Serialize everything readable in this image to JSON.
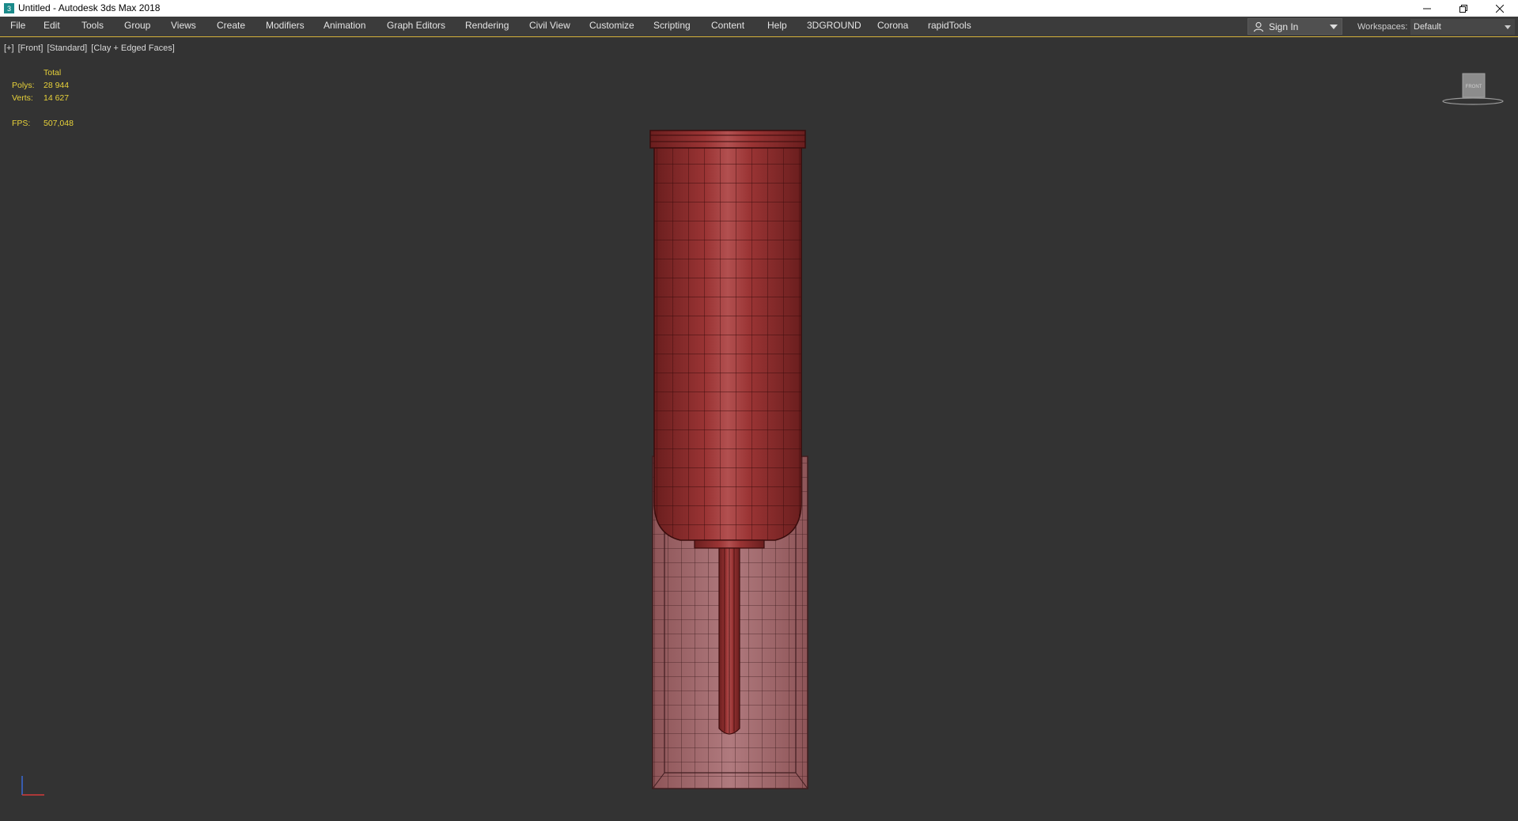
{
  "window": {
    "title": "Untitled - Autodesk 3ds Max 2018"
  },
  "menubar": {
    "items": [
      "File",
      "Edit",
      "Tools",
      "Group",
      "Views",
      "Create",
      "Modifiers",
      "Animation",
      "Graph Editors",
      "Rendering",
      "Civil View",
      "Customize",
      "Scripting",
      "Content",
      "Help",
      "3DGROUND",
      "Corona",
      "rapidTools"
    ]
  },
  "signin": {
    "label": "Sign In"
  },
  "workspaces": {
    "label": "Workspaces:",
    "value": "Default"
  },
  "viewport": {
    "labels": [
      "[+]",
      "[Front]",
      "[Standard]",
      "[Clay + Edged Faces]"
    ],
    "stats": {
      "header": "Total",
      "polys_label": "Polys:",
      "polys_value": "28 944",
      "verts_label": "Verts:",
      "verts_value": "14 627",
      "fps_label": "FPS:",
      "fps_value": "507,048"
    },
    "navcube_face": "FRONT"
  },
  "colors": {
    "viewport_bg": "#333333",
    "mesh_red": "#8e2c2c",
    "box_pink": "#a86a6e",
    "stats_yellow": "#e8d23a"
  }
}
